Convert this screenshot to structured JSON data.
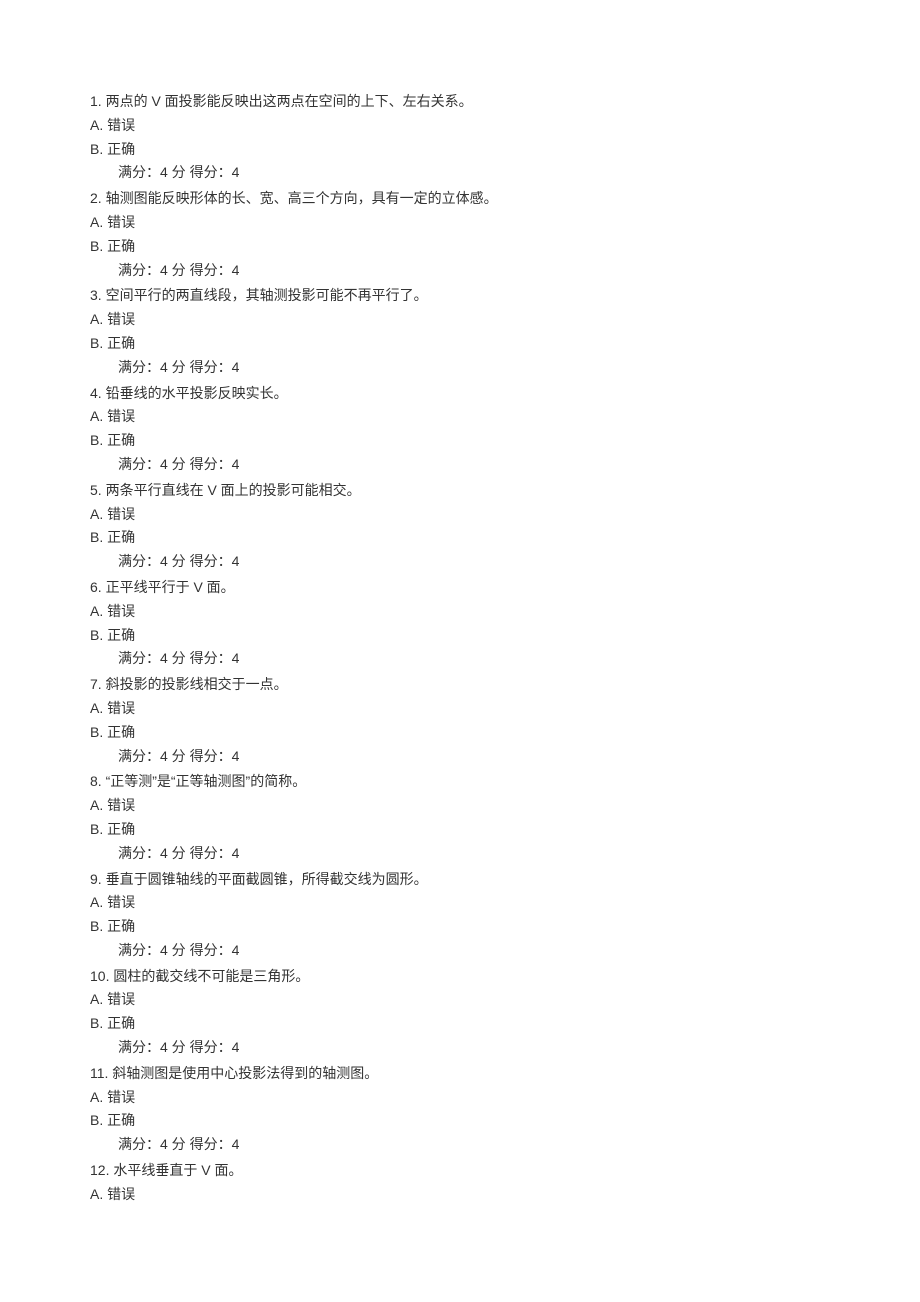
{
  "option_a_label": "A.  错误",
  "option_b_label": "B.  正确",
  "score_text": "满分：4 分  得分：4",
  "questions": [
    {
      "num": "1.",
      "stem": "两点的 V 面投影能反映出这两点在空间的上下、左右关系。"
    },
    {
      "num": "2.",
      "stem": "轴测图能反映形体的长、宽、高三个方向，具有一定的立体感。"
    },
    {
      "num": "3.",
      "stem": "空间平行的两直线段，其轴测投影可能不再平行了。"
    },
    {
      "num": "4.",
      "stem": "铅垂线的水平投影反映实长。"
    },
    {
      "num": "5.",
      "stem": "两条平行直线在 V 面上的投影可能相交。"
    },
    {
      "num": "6.",
      "stem": "正平线平行于 V 面。"
    },
    {
      "num": "7.",
      "stem": "斜投影的投影线相交于一点。"
    },
    {
      "num": "8.",
      "stem": "“正等测”是“正等轴测图”的简称。"
    },
    {
      "num": "9.",
      "stem": "垂直于圆锥轴线的平面截圆锥，所得截交线为圆形。"
    },
    {
      "num": "10.",
      "stem": "圆柱的截交线不可能是三角形。"
    },
    {
      "num": "11.",
      "stem": "斜轴测图是使用中心投影法得到的轴测图。"
    },
    {
      "num": "12.",
      "stem": "水平线垂直于 V 面。",
      "no_b": true,
      "no_score": true
    }
  ]
}
